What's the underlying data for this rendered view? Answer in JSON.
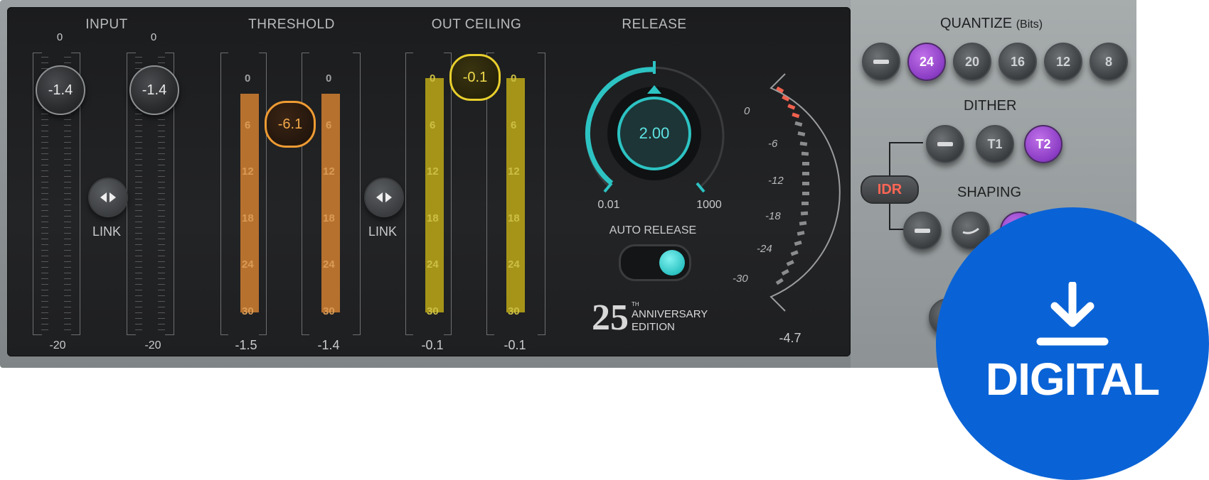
{
  "input": {
    "title": "INPUT",
    "left": {
      "top": "0",
      "value": "-1.4",
      "bottom": "-20"
    },
    "right": {
      "top": "0",
      "value": "-1.4",
      "bottom": "-20"
    },
    "link_label": "LINK",
    "link_icon": "link-arrows-icon"
  },
  "threshold": {
    "title": "THRESHOLD",
    "value": "-6.1",
    "left_bottom": "-1.5",
    "right_bottom": "-1.4",
    "scale": [
      "0",
      "6",
      "12",
      "18",
      "24",
      "30"
    ],
    "level_fraction": 0.9,
    "link_label": "LINK"
  },
  "out_ceiling": {
    "title": "OUT CEILING",
    "value": "-0.1",
    "left_bottom": "-0.1",
    "right_bottom": "-0.1",
    "scale": [
      "0",
      "6",
      "12",
      "18",
      "24",
      "30"
    ]
  },
  "release": {
    "title": "RELEASE",
    "value": "2.00",
    "min_label": "0.01",
    "max_label": "1000",
    "auto_release_label": "AUTO RELEASE",
    "auto_release_on": true
  },
  "edition": {
    "number": "25",
    "th": "TH",
    "line1": "ANNIVERSARY",
    "line2": "EDITION"
  },
  "output_meter": {
    "scale": [
      "0",
      "-6",
      "-12",
      "-18",
      "-24",
      "-30"
    ],
    "reading": "-4.7"
  },
  "quantize": {
    "title": "QUANTIZE",
    "subtitle": "(Bits)",
    "options": [
      "—",
      "24",
      "20",
      "16",
      "12",
      "8"
    ],
    "selected": "24"
  },
  "dither": {
    "title": "DITHER",
    "options": [
      "—",
      "T1",
      "T2"
    ],
    "selected": "T2"
  },
  "idr_label": "IDR",
  "shaping": {
    "title": "SHAPING"
  },
  "badge": {
    "label": "DIGITAL",
    "icon": "download-icon"
  },
  "colors": {
    "threshold": "#ee9b33",
    "ceiling": "#e8cf2d",
    "release": "#2dc3c3",
    "selected": "#a550d8",
    "badge": "#0a63d6"
  }
}
